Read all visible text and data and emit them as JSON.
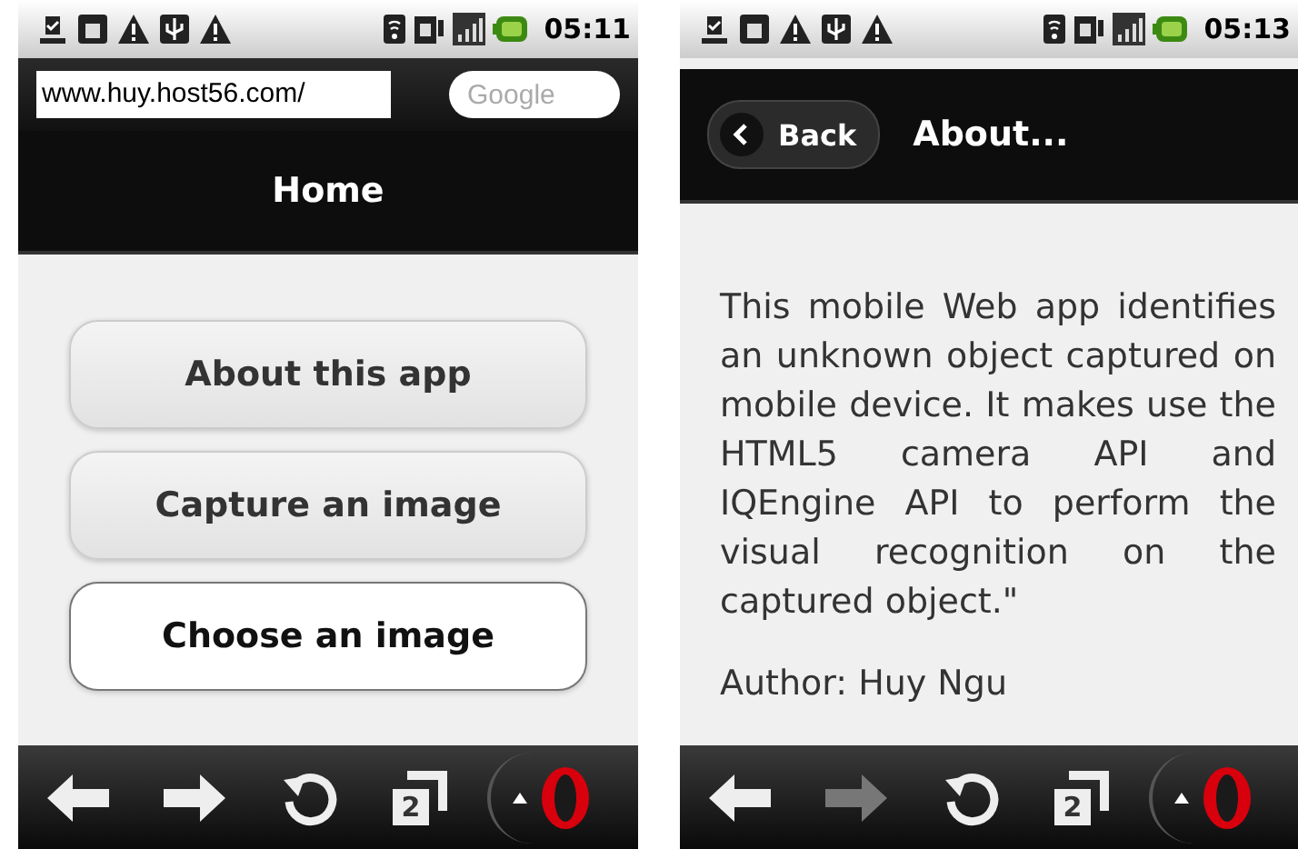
{
  "phones": [
    {
      "status_bar": {
        "time": "05:11"
      },
      "address_bar": {
        "url": "www.huy.host56.com/",
        "search_placeholder": "Google"
      },
      "header": {
        "title": "Home"
      },
      "menu": [
        {
          "label": "About this app",
          "selected": false
        },
        {
          "label": "Capture an image",
          "selected": false
        },
        {
          "label": "Choose an image",
          "selected": true
        }
      ],
      "toolbar": {
        "forward_disabled": false,
        "tab_count": "2"
      }
    },
    {
      "status_bar": {
        "time": "05:13"
      },
      "header": {
        "back_label": "Back",
        "title": "About..."
      },
      "body": {
        "paragraph": "This mobile Web app identifies an unknown object captured on mobile device. It makes use the HTML5 camera API and IQEngine API to perform the visual recognition on the captured object.\"",
        "author": "Author: Huy Ngu"
      },
      "toolbar": {
        "forward_disabled": true,
        "tab_count": "2"
      }
    }
  ]
}
